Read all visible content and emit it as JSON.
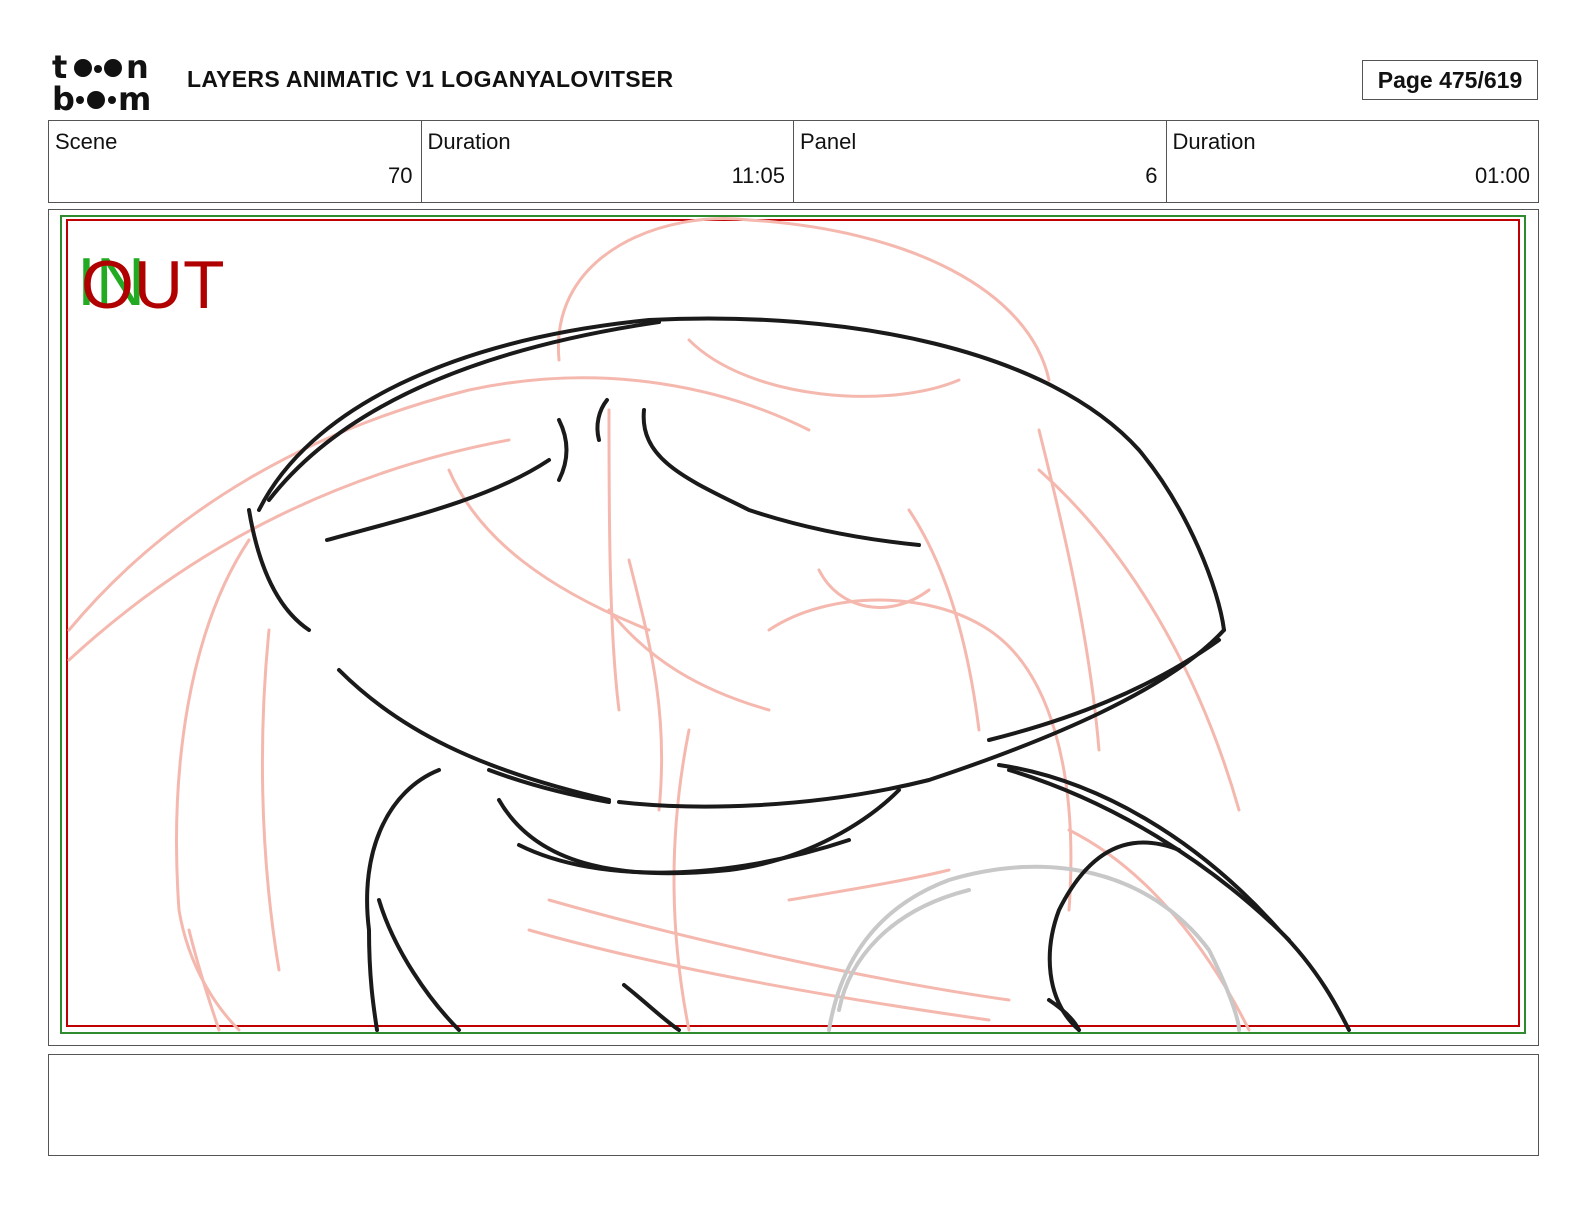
{
  "header": {
    "logo_line1": "toon",
    "logo_line2": "boom",
    "title": "LAYERS ANIMATIC V1 LOGANYALOVITSER",
    "page": "Page 475/619"
  },
  "info": {
    "scene_label": "Scene",
    "scene_value": "70",
    "scene_duration_label": "Duration",
    "scene_duration_value": "11:05",
    "panel_label": "Panel",
    "panel_value": "6",
    "panel_duration_label": "Duration",
    "panel_duration_value": "01:00"
  },
  "panel": {
    "in_marker": "IN",
    "out_marker": "OUT"
  },
  "notes": {
    "text": ""
  },
  "colors": {
    "in_marker": "#22aa22",
    "out_marker": "#b00000",
    "sketch_lines": "#1a1a1a",
    "rough_lines": "#f5b8ae",
    "ghost_lines": "#c8c8c8",
    "safe_frame_green": "#2e8b2e",
    "safe_frame_red": "#c00000"
  }
}
